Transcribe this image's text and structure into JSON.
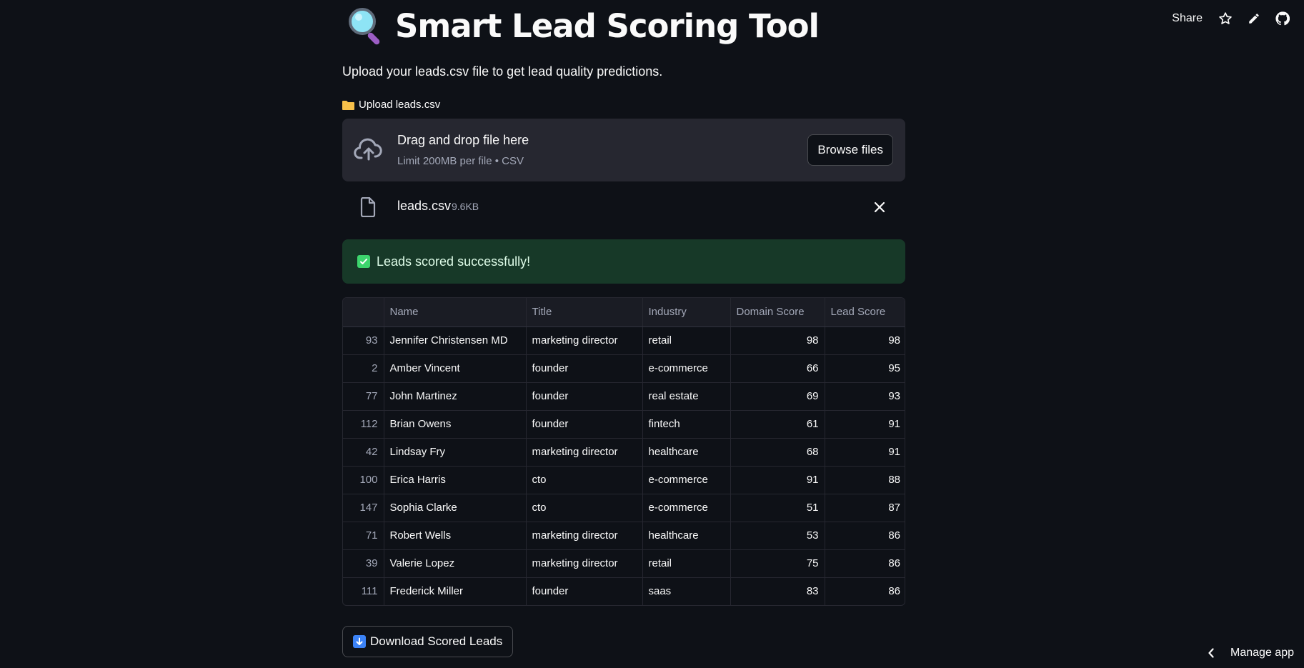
{
  "toolbar": {
    "share_label": "Share",
    "icons": [
      "star-icon",
      "pencil-icon",
      "github-icon"
    ]
  },
  "page": {
    "title": "Smart Lead Scoring Tool",
    "title_icon": "magnifying-glass-icon",
    "subtitle": "Upload your leads.csv file to get lead quality predictions."
  },
  "uploader": {
    "label": "Upload leads.csv",
    "label_icon": "folder-icon",
    "drop_text": "Drag and drop file here",
    "limit_text": "Limit 200MB per file • CSV",
    "browse_label": "Browse files"
  },
  "file": {
    "name": "leads.csv",
    "size": "9.6KB"
  },
  "alert": {
    "message": "Leads scored successfully!",
    "color": "#173928"
  },
  "table": {
    "columns": [
      "",
      "Name",
      "Title",
      "Industry",
      "Domain Score",
      "Lead Score"
    ],
    "rows": [
      [
        "93",
        "Jennifer Christensen MD",
        "marketing director",
        "retail",
        "98",
        "98"
      ],
      [
        "2",
        "Amber Vincent",
        "founder",
        "e-commerce",
        "66",
        "95"
      ],
      [
        "77",
        "John Martinez",
        "founder",
        "real estate",
        "69",
        "93"
      ],
      [
        "112",
        "Brian Owens",
        "founder",
        "fintech",
        "61",
        "91"
      ],
      [
        "42",
        "Lindsay Fry",
        "marketing director",
        "healthcare",
        "68",
        "91"
      ],
      [
        "100",
        "Erica Harris",
        "cto",
        "e-commerce",
        "91",
        "88"
      ],
      [
        "147",
        "Sophia Clarke",
        "cto",
        "e-commerce",
        "51",
        "87"
      ],
      [
        "71",
        "Robert Wells",
        "marketing director",
        "healthcare",
        "53",
        "86"
      ],
      [
        "39",
        "Valerie Lopez",
        "marketing director",
        "retail",
        "75",
        "86"
      ],
      [
        "111",
        "Frederick Miller",
        "founder",
        "saas",
        "83",
        "86"
      ]
    ]
  },
  "download": {
    "label": "Download Scored Leads",
    "icon": "down-arrow-icon"
  },
  "footer": {
    "manage_label": "Manage app"
  }
}
